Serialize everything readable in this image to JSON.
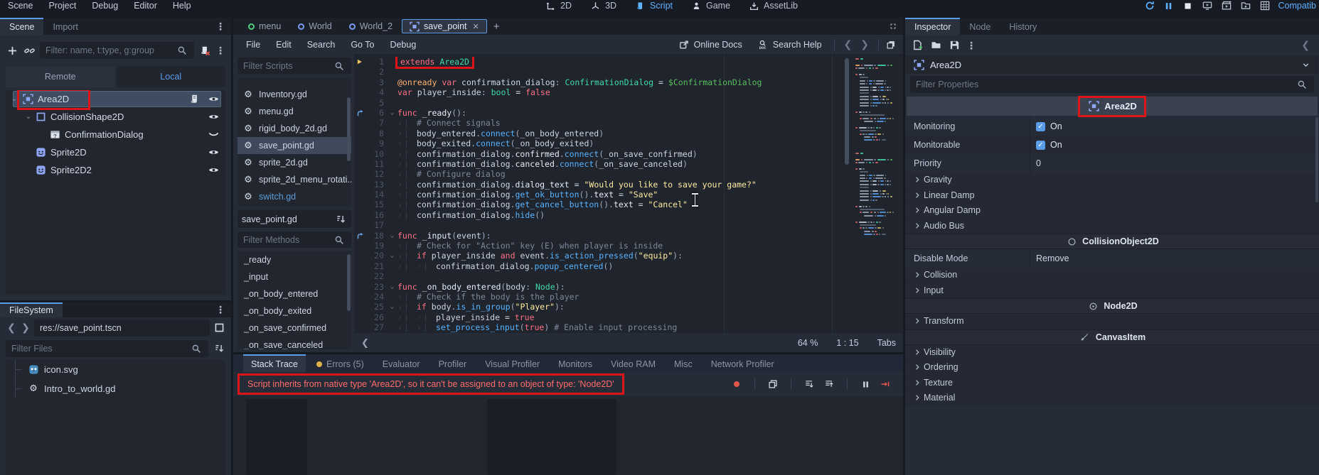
{
  "colors": {
    "accent": "#5b9ce8",
    "error_red": "#ff6b6b",
    "annotation_red": "#dd1418",
    "keyword": "#ff7085",
    "type": "#42d9ac",
    "string": "#ffeca1",
    "node_path": "#5abf5e",
    "function": "#57b3ff"
  },
  "menubar": {
    "menus": [
      "Scene",
      "Project",
      "Debug",
      "Editor",
      "Help"
    ],
    "workspaces": [
      {
        "label": "2D",
        "icon": "ws-2d-icon",
        "active": false
      },
      {
        "label": "3D",
        "icon": "ws-3d-icon",
        "active": false
      },
      {
        "label": "Script",
        "icon": "ws-script-icon",
        "active": true
      },
      {
        "label": "Game",
        "icon": "ws-game-icon",
        "active": false
      },
      {
        "label": "AssetLib",
        "icon": "ws-assetlib-icon",
        "active": false
      }
    ],
    "playback_icons": [
      "reload",
      "pause-blue",
      "stop",
      "remote-debug",
      "play-scene",
      "play-custom",
      "movie"
    ],
    "renderer": "Compatib"
  },
  "scene_dock": {
    "tabs": [
      {
        "label": "Scene",
        "active": true
      },
      {
        "label": "Import",
        "active": false
      }
    ],
    "toolbar": {
      "filter_placeholder": "Filter: name, t:type, g:group",
      "icons_left": [
        "add-node",
        "instance-scene"
      ],
      "icons_right": [
        "detach-script",
        "more"
      ]
    },
    "remote_local": [
      {
        "label": "Remote",
        "active": false
      },
      {
        "label": "Local",
        "active": true
      }
    ],
    "tree": [
      {
        "label": "Area2D",
        "icon": "area2d",
        "depth": 0,
        "arrow": true,
        "selected": true,
        "annotated": true,
        "rights": [
          "script-scroll",
          "eye-open"
        ]
      },
      {
        "label": "CollisionShape2D",
        "icon": "collisionshape2d",
        "depth": 1,
        "arrow": true,
        "rights": [
          "eye-open"
        ]
      },
      {
        "label": "ConfirmationDialog",
        "icon": "confirmationdialog",
        "depth": 2,
        "arrow": false,
        "rights": [
          "eye-closed"
        ]
      },
      {
        "label": "Sprite2D",
        "icon": "sprite2d",
        "depth": 1,
        "arrow": false,
        "rights": [
          "eye-open"
        ]
      },
      {
        "label": "Sprite2D2",
        "icon": "sprite2d",
        "depth": 1,
        "arrow": false,
        "rights": [
          "eye-open"
        ]
      }
    ]
  },
  "filesystem": {
    "tab": "FileSystem",
    "path": "res://save_point.tscn",
    "filter_placeholder": "Filter Files",
    "files": [
      {
        "name": "icon.svg",
        "icon": "godot-logo"
      },
      {
        "name": "Intro_to_world.gd",
        "icon": "gear"
      }
    ]
  },
  "script_editor": {
    "scene_tabs": [
      {
        "label": "menu",
        "ring": "#4fd17e"
      },
      {
        "label": "World",
        "ring": "#7d9bf0"
      },
      {
        "label": "World_2",
        "ring": "#7d9bf0"
      },
      {
        "label": "save_point",
        "icon": "area2d",
        "active": true,
        "close": "✕"
      }
    ],
    "plus_label": "+",
    "menus": [
      "File",
      "Edit",
      "Search",
      "Go To",
      "Debug"
    ],
    "links": [
      {
        "label": "Online Docs",
        "icon": "external-link"
      },
      {
        "label": "Search Help",
        "icon": "help-doc"
      }
    ],
    "scripts_filter_placeholder": "Filter Scripts",
    "scripts": [
      {
        "name": "Inventory.gd"
      },
      {
        "name": "menu.gd"
      },
      {
        "name": "rigid_body_2d.gd"
      },
      {
        "name": "save_point.gd",
        "selected": true
      },
      {
        "name": "sprite_2d.gd"
      },
      {
        "name": "sprite_2d_menu_rotati..."
      },
      {
        "name": "switch.gd",
        "blue": true
      }
    ],
    "current_script": "save_point.gd",
    "methods_filter_placeholder": "Filter Methods",
    "methods": [
      "_ready",
      "_input",
      "_on_body_entered",
      "_on_body_exited",
      "_on_save_confirmed",
      "_on_save_canceled"
    ],
    "status": {
      "zoom": "64 %",
      "line_col": "1 : 15",
      "indent": "Tabs"
    }
  },
  "code": {
    "lines": [
      {
        "n": 1,
        "t": 0,
        "g": "bookmark",
        "box": true,
        "s": [
          [
            "extends",
            "kw"
          ],
          [
            " ",
            "pu"
          ],
          [
            "Area2D",
            "ty"
          ]
        ]
      },
      {
        "n": 2,
        "t": 0,
        "s": []
      },
      {
        "n": 3,
        "t": 0,
        "s": [
          [
            "@onready",
            "an"
          ],
          [
            " ",
            "pu"
          ],
          [
            "var",
            "kw"
          ],
          [
            " ",
            "pu"
          ],
          [
            "confirmation_dialog",
            "id"
          ],
          [
            ":",
            "pu"
          ],
          [
            " ",
            "pu"
          ],
          [
            "ConfirmationDialog",
            "ty"
          ],
          [
            " ",
            "pu"
          ],
          [
            "=",
            "op"
          ],
          [
            " ",
            "pu"
          ],
          [
            "$ConfirmationDialog",
            "np"
          ]
        ]
      },
      {
        "n": 4,
        "t": 0,
        "s": [
          [
            "var",
            "kw"
          ],
          [
            " ",
            "pu"
          ],
          [
            "player_inside",
            "id"
          ],
          [
            ":",
            "pu"
          ],
          [
            " ",
            "pu"
          ],
          [
            "bool",
            "ty"
          ],
          [
            " ",
            "pu"
          ],
          [
            "=",
            "op"
          ],
          [
            " ",
            "pu"
          ],
          [
            "false",
            "kw"
          ]
        ]
      },
      {
        "n": 5,
        "t": 0,
        "s": []
      },
      {
        "n": 6,
        "t": 0,
        "g": "connect",
        "f": true,
        "s": [
          [
            "func",
            "kw"
          ],
          [
            " ",
            "pu"
          ],
          [
            "_ready",
            "mb"
          ],
          [
            "():",
            "pu"
          ]
        ]
      },
      {
        "n": 7,
        "t": 1,
        "s": [
          [
            "# Connect signals",
            "cm"
          ]
        ]
      },
      {
        "n": 8,
        "t": 1,
        "s": [
          [
            "body_entered",
            "id"
          ],
          [
            ".",
            "pu"
          ],
          [
            "connect",
            "fn"
          ],
          [
            "(",
            "pu"
          ],
          [
            "_on_body_entered",
            "id"
          ],
          [
            ")",
            "pu"
          ]
        ]
      },
      {
        "n": 9,
        "t": 1,
        "s": [
          [
            "body_exited",
            "id"
          ],
          [
            ".",
            "pu"
          ],
          [
            "connect",
            "fn"
          ],
          [
            "(",
            "pu"
          ],
          [
            "_on_body_exited",
            "id"
          ],
          [
            ")",
            "pu"
          ]
        ]
      },
      {
        "n": 10,
        "t": 1,
        "s": [
          [
            "confirmation_dialog",
            "id"
          ],
          [
            ".",
            "pu"
          ],
          [
            "confirmed",
            "mb"
          ],
          [
            ".",
            "pu"
          ],
          [
            "connect",
            "fn"
          ],
          [
            "(",
            "pu"
          ],
          [
            "_on_save_confirmed",
            "id"
          ],
          [
            ")",
            "pu"
          ]
        ]
      },
      {
        "n": 11,
        "t": 1,
        "s": [
          [
            "confirmation_dialog",
            "id"
          ],
          [
            ".",
            "pu"
          ],
          [
            "canceled",
            "mb"
          ],
          [
            ".",
            "pu"
          ],
          [
            "connect",
            "fn"
          ],
          [
            "(",
            "pu"
          ],
          [
            "_on_save_canceled",
            "id"
          ],
          [
            ")",
            "pu"
          ]
        ]
      },
      {
        "n": 12,
        "t": 1,
        "s": [
          [
            "# Configure dialog",
            "cm"
          ]
        ]
      },
      {
        "n": 13,
        "t": 1,
        "s": [
          [
            "confirmation_dialog",
            "id"
          ],
          [
            ".",
            "pu"
          ],
          [
            "dialog_text",
            "mb"
          ],
          [
            " ",
            "pu"
          ],
          [
            "=",
            "op"
          ],
          [
            " ",
            "pu"
          ],
          [
            "\"Would you like to save your game?\"",
            "st"
          ]
        ]
      },
      {
        "n": 14,
        "t": 1,
        "s": [
          [
            "confirmation_dialog",
            "id"
          ],
          [
            ".",
            "pu"
          ],
          [
            "get_ok_button",
            "fn"
          ],
          [
            "().",
            "pu"
          ],
          [
            "text",
            "mb"
          ],
          [
            " ",
            "pu"
          ],
          [
            "=",
            "op"
          ],
          [
            " ",
            "pu"
          ],
          [
            "\"Save\"",
            "st"
          ]
        ]
      },
      {
        "n": 15,
        "t": 1,
        "s": [
          [
            "confirmation_dialog",
            "id"
          ],
          [
            ".",
            "pu"
          ],
          [
            "get_cancel_button",
            "fn"
          ],
          [
            "().",
            "pu"
          ],
          [
            "text",
            "mb"
          ],
          [
            " ",
            "pu"
          ],
          [
            "=",
            "op"
          ],
          [
            " ",
            "pu"
          ],
          [
            "\"Cancel\"",
            "st"
          ]
        ]
      },
      {
        "n": 16,
        "t": 1,
        "s": [
          [
            "confirmation_dialog",
            "id"
          ],
          [
            ".",
            "pu"
          ],
          [
            "hide",
            "fn"
          ],
          [
            "()",
            "pu"
          ]
        ]
      },
      {
        "n": 17,
        "t": 0,
        "s": []
      },
      {
        "n": 18,
        "t": 0,
        "g": "connect",
        "f": true,
        "s": [
          [
            "func",
            "kw"
          ],
          [
            " ",
            "pu"
          ],
          [
            "_input",
            "mb"
          ],
          [
            "(",
            "pu"
          ],
          [
            "event",
            "id"
          ],
          [
            "):",
            "pu"
          ]
        ]
      },
      {
        "n": 19,
        "t": 1,
        "s": [
          [
            "# Check for \"Action\" key (E) when player is inside",
            "cm"
          ]
        ]
      },
      {
        "n": 20,
        "t": 1,
        "f": true,
        "s": [
          [
            "if",
            "kw"
          ],
          [
            " ",
            "pu"
          ],
          [
            "player_inside",
            "id"
          ],
          [
            " ",
            "pu"
          ],
          [
            "and",
            "kw"
          ],
          [
            " ",
            "pu"
          ],
          [
            "event",
            "id"
          ],
          [
            ".",
            "pu"
          ],
          [
            "is_action_pressed",
            "fn"
          ],
          [
            "(",
            "pu"
          ],
          [
            "\"equip\"",
            "st"
          ],
          [
            "):",
            "pu"
          ]
        ]
      },
      {
        "n": 21,
        "t": 2,
        "s": [
          [
            "confirmation_dialog",
            "id"
          ],
          [
            ".",
            "pu"
          ],
          [
            "popup_centered",
            "fn"
          ],
          [
            "()",
            "pu"
          ]
        ]
      },
      {
        "n": 22,
        "t": 0,
        "s": []
      },
      {
        "n": 23,
        "t": 0,
        "f": true,
        "s": [
          [
            "func",
            "kw"
          ],
          [
            " ",
            "pu"
          ],
          [
            "_on_body_entered",
            "mb"
          ],
          [
            "(",
            "pu"
          ],
          [
            "body",
            "id"
          ],
          [
            ":",
            "pu"
          ],
          [
            " ",
            "pu"
          ],
          [
            "Node",
            "ty"
          ],
          [
            "):",
            "pu"
          ]
        ]
      },
      {
        "n": 24,
        "t": 1,
        "s": [
          [
            "# Check if the body is the player",
            "cm"
          ]
        ]
      },
      {
        "n": 25,
        "t": 1,
        "f": true,
        "s": [
          [
            "if",
            "kw"
          ],
          [
            " ",
            "pu"
          ],
          [
            "body",
            "id"
          ],
          [
            ".",
            "pu"
          ],
          [
            "is_in_group",
            "fn"
          ],
          [
            "(",
            "pu"
          ],
          [
            "\"Player\"",
            "st"
          ],
          [
            "):",
            "pu"
          ]
        ]
      },
      {
        "n": 26,
        "t": 2,
        "s": [
          [
            "player_inside",
            "id"
          ],
          [
            " ",
            "pu"
          ],
          [
            "=",
            "op"
          ],
          [
            " ",
            "pu"
          ],
          [
            "true",
            "kw"
          ]
        ]
      },
      {
        "n": 27,
        "t": 2,
        "s": [
          [
            "set_process_input",
            "fn"
          ],
          [
            "(",
            "pu"
          ],
          [
            "true",
            "kw"
          ],
          [
            ")",
            "pu"
          ],
          [
            " ",
            "pu"
          ],
          [
            "# Enable input processing",
            "cm"
          ]
        ]
      }
    ]
  },
  "debugger": {
    "tabs": [
      {
        "label": "Stack Trace",
        "active": true
      },
      {
        "label": "Errors (5)",
        "dot": true
      },
      {
        "label": "Evaluator"
      },
      {
        "label": "Profiler"
      },
      {
        "label": "Visual Profiler"
      },
      {
        "label": "Monitors"
      },
      {
        "label": "Video RAM"
      },
      {
        "label": "Misc"
      },
      {
        "label": "Network Profiler"
      }
    ],
    "error_message": "Script inherits from native type 'Area2D', so it can't be assigned to an object of type: 'Node2D'",
    "tool_icons": [
      "record-dot",
      "copy",
      "expand-all",
      "collapse-all",
      "pause-gray",
      "continue"
    ]
  },
  "inspector": {
    "tabs": [
      {
        "label": "Inspector",
        "active": true
      },
      {
        "label": "Node"
      },
      {
        "label": "History"
      }
    ],
    "toolbar_icons": [
      "new-resource",
      "load-resource",
      "save-resource",
      "more"
    ],
    "node": {
      "label": "Area2D",
      "icon": "area2d"
    },
    "filter_placeholder": "Filter Properties",
    "rows": [
      {
        "type": "section",
        "label": "Area2D",
        "icon": "area2d",
        "annotated": true
      },
      {
        "type": "check",
        "label": "Monitoring",
        "value": "On",
        "checked": true
      },
      {
        "type": "check",
        "label": "Monitorable",
        "value": "On",
        "checked": true
      },
      {
        "type": "prop",
        "label": "Priority",
        "value": "0"
      },
      {
        "type": "group",
        "label": "Gravity"
      },
      {
        "type": "group",
        "label": "Linear Damp"
      },
      {
        "type": "group",
        "label": "Angular Damp"
      },
      {
        "type": "group",
        "label": "Audio Bus"
      },
      {
        "type": "category",
        "label": "CollisionObject2D",
        "icon": "collisionobject2d"
      },
      {
        "type": "prop",
        "label": "Disable Mode",
        "value": "Remove"
      },
      {
        "type": "group",
        "label": "Collision"
      },
      {
        "type": "group",
        "label": "Input"
      },
      {
        "type": "category",
        "label": "Node2D",
        "icon": "node2d"
      },
      {
        "type": "group",
        "label": "Transform"
      },
      {
        "type": "category",
        "label": "CanvasItem",
        "icon": "canvasitem"
      },
      {
        "type": "group",
        "label": "Visibility"
      },
      {
        "type": "group",
        "label": "Ordering"
      },
      {
        "type": "group",
        "label": "Texture"
      },
      {
        "type": "group",
        "label": "Material"
      }
    ]
  }
}
